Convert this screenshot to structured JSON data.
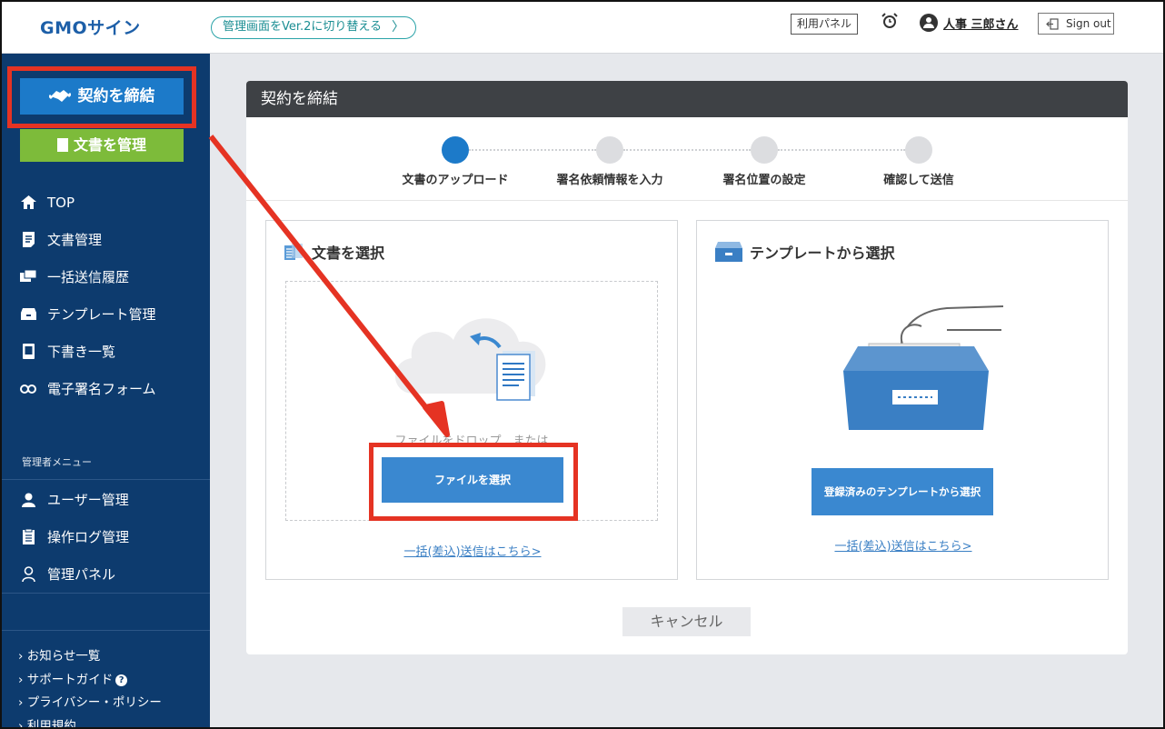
{
  "header": {
    "logo": "GMOサイン",
    "version_switch": "管理画面をVer.2に切り替える",
    "panel_button": "利用パネル",
    "user_name": "人事 三郎さん",
    "signout": "Sign out"
  },
  "sidebar": {
    "primary_button": "契約を締結",
    "manage_button": "文書を管理",
    "nav": [
      {
        "label": "TOP",
        "icon": "home-icon"
      },
      {
        "label": "文書管理",
        "icon": "document-icon"
      },
      {
        "label": "一括送信履歴",
        "icon": "bulk-send-icon"
      },
      {
        "label": "テンプレート管理",
        "icon": "template-icon"
      },
      {
        "label": "下書き一覧",
        "icon": "draft-icon"
      },
      {
        "label": "電子署名フォーム",
        "icon": "link-icon"
      }
    ],
    "admin_title": "管理者メニュー",
    "admin_nav": [
      {
        "label": "ユーザー管理",
        "icon": "user-icon"
      },
      {
        "label": "操作ログ管理",
        "icon": "log-icon"
      },
      {
        "label": "管理パネル",
        "icon": "panel-icon"
      }
    ],
    "footer_links": [
      "お知らせ一覧",
      "サポートガイド",
      "プライバシー・ポリシー",
      "利用規約"
    ]
  },
  "card": {
    "title": "契約を締結",
    "steps": [
      "文書のアップロード",
      "署名依頼情報を入力",
      "署名位置の設定",
      "確認して送信"
    ],
    "upload": {
      "title": "文書を選択",
      "drop_text": "ファイルをドロップ　または",
      "button": "ファイルを選択",
      "link": "一括(差込)送信はこちら>"
    },
    "template": {
      "title": "テンプレートから選択",
      "button": "登録済みのテンプレートから選択",
      "link": "一括(差込)送信はこちら>"
    },
    "cancel": "キャンセル"
  },
  "colors": {
    "sidebar_bg": "#0d3b6e",
    "accent_blue": "#1c7ac9",
    "green": "#7dbb3a",
    "annotation_red": "#e53323"
  }
}
